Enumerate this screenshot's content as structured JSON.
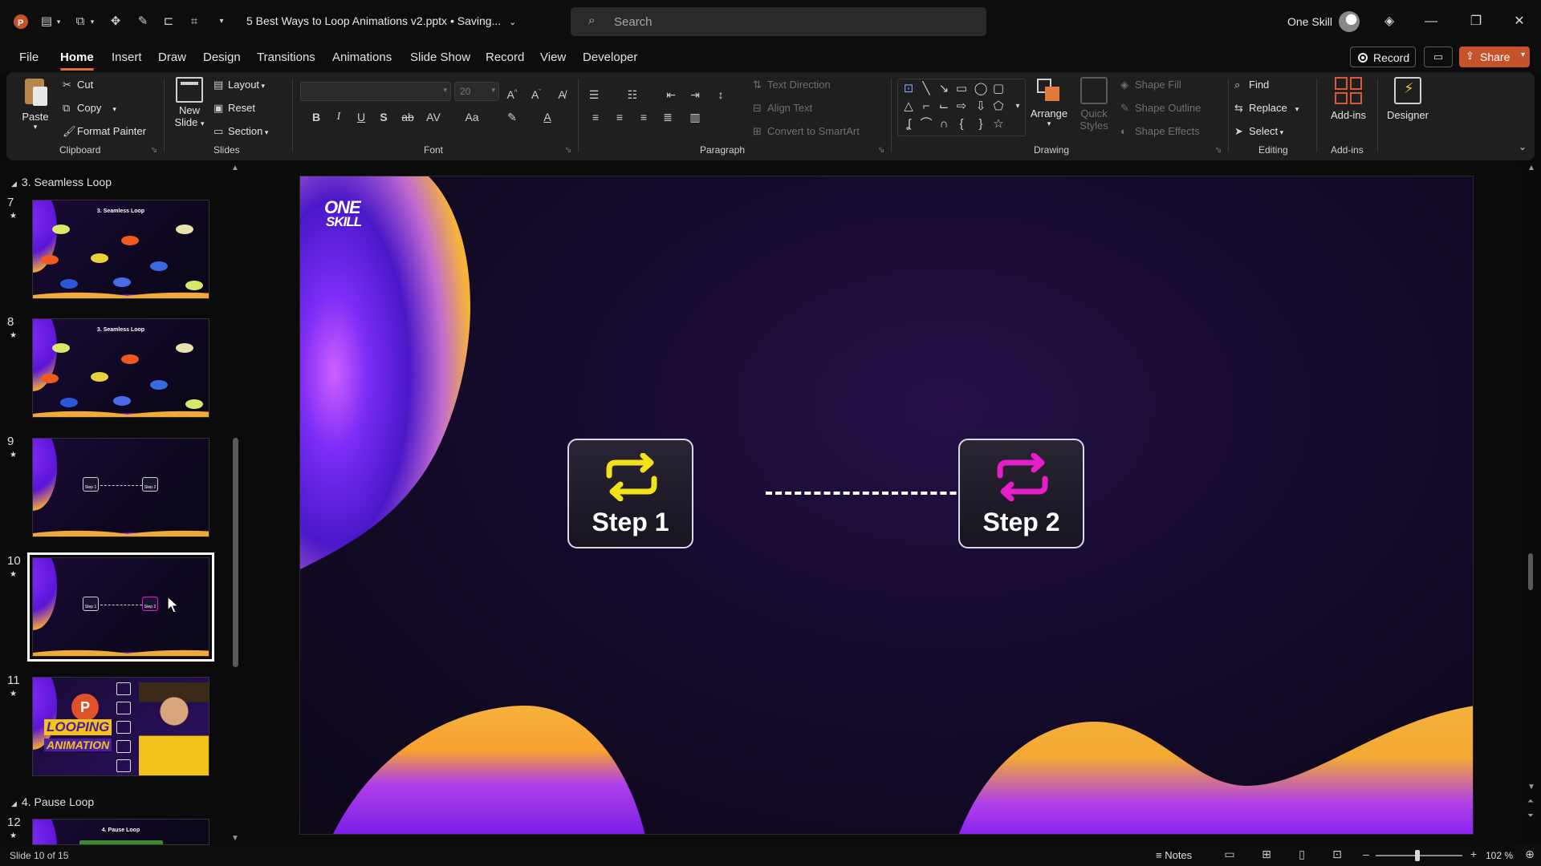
{
  "titlebar": {
    "doc_title": "5 Best Ways to Loop Animations v2.pptx • Saving...",
    "search_placeholder": "Search",
    "user_name": "One Skill"
  },
  "menu": {
    "tabs": [
      "File",
      "Home",
      "Insert",
      "Draw",
      "Design",
      "Transitions",
      "Animations",
      "Slide Show",
      "Record",
      "View",
      "Developer"
    ],
    "active": "Home",
    "record_label": "Record",
    "share_label": "Share"
  },
  "ribbon": {
    "clipboard": {
      "paste": "Paste",
      "cut": "Cut",
      "copy": "Copy",
      "format_painter": "Format Painter",
      "label": "Clipboard"
    },
    "slides": {
      "new_slide_1": "New",
      "new_slide_2": "Slide",
      "layout": "Layout",
      "reset": "Reset",
      "section": "Section",
      "label": "Slides"
    },
    "font": {
      "size": "20",
      "label": "Font"
    },
    "paragraph": {
      "text_direction": "Text Direction",
      "align_text": "Align Text",
      "convert_smartart": "Convert to SmartArt",
      "label": "Paragraph"
    },
    "drawing": {
      "arrange": "Arrange",
      "quick_styles_1": "Quick",
      "quick_styles_2": "Styles",
      "shape_fill": "Shape Fill",
      "shape_outline": "Shape Outline",
      "shape_effects": "Shape Effects",
      "label": "Drawing"
    },
    "editing": {
      "find": "Find",
      "replace": "Replace",
      "select": "Select",
      "label": "Editing"
    },
    "addins": {
      "addins": "Add-ins",
      "designer": "Designer",
      "label": "Add-ins"
    }
  },
  "thumbnails": {
    "section3": "3. Seamless Loop",
    "section4": "4. Pause Loop",
    "slides": [
      {
        "num": "7",
        "title": "3. Seamless Loop"
      },
      {
        "num": "8",
        "title": "3. Seamless Loop"
      },
      {
        "num": "9",
        "step1": "Step 1",
        "step2": "Step 2"
      },
      {
        "num": "10",
        "step1": "Step 1",
        "step2": "Step 2"
      },
      {
        "num": "11",
        "banner1": "LOOPING",
        "banner2": "ANIMATION"
      },
      {
        "num": "12",
        "title": "4. Pause Loop"
      }
    ]
  },
  "slide": {
    "logo_line1": "ONE",
    "logo_line2": "SKILL",
    "step1": "Step 1",
    "step2": "Step 2",
    "step1_color": "#f2e21a",
    "step2_color": "#e51ec9"
  },
  "status": {
    "slide_info": "Slide 10 of 15",
    "notes": "Notes",
    "zoom": "102 %"
  },
  "colors": {
    "accent": "#c4532c",
    "purple": "#7a2cf0",
    "gold": "#f2a93b"
  }
}
